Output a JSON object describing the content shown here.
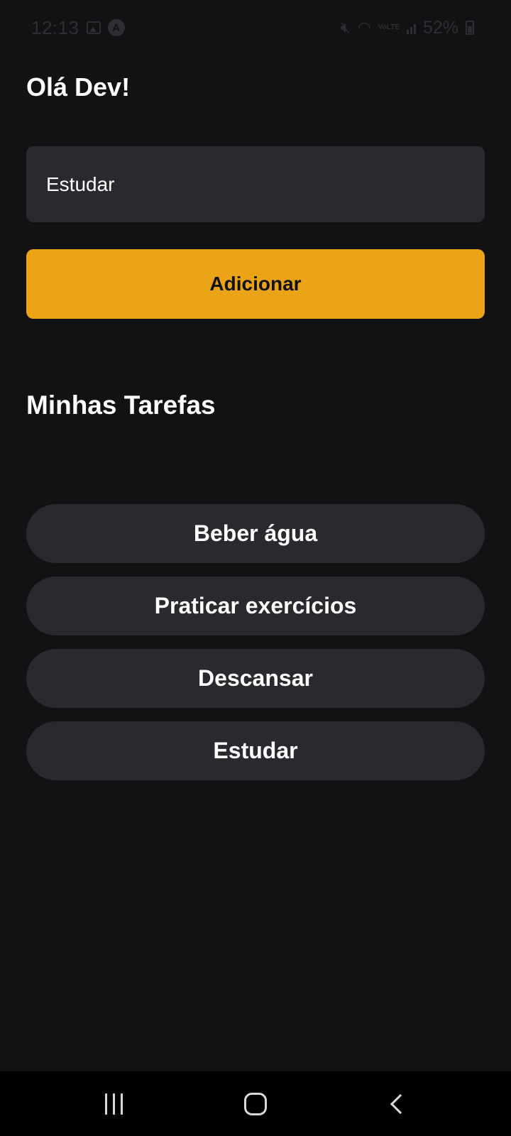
{
  "status_bar": {
    "time": "12:13",
    "battery": "52%",
    "volte_label": "VoLTE",
    "icons": [
      "gallery-icon",
      "a-icon",
      "mute-icon",
      "wifi-icon",
      "volte-icon",
      "signal-icon",
      "battery-icon"
    ]
  },
  "header": {
    "greeting": "Olá Dev!"
  },
  "form": {
    "input_value": "Estudar",
    "add_label": "Adicionar"
  },
  "tasks": {
    "title": "Minhas Tarefas",
    "items": [
      {
        "label": "Beber água"
      },
      {
        "label": "Praticar exercícios"
      },
      {
        "label": "Descansar"
      },
      {
        "label": "Estudar"
      }
    ]
  },
  "nav_bar": {
    "icons": [
      "recents-icon",
      "home-icon",
      "back-icon"
    ]
  },
  "colors": {
    "background": "#121214",
    "surface": "#29292e",
    "accent": "#eba417",
    "text": "#ffffff"
  }
}
